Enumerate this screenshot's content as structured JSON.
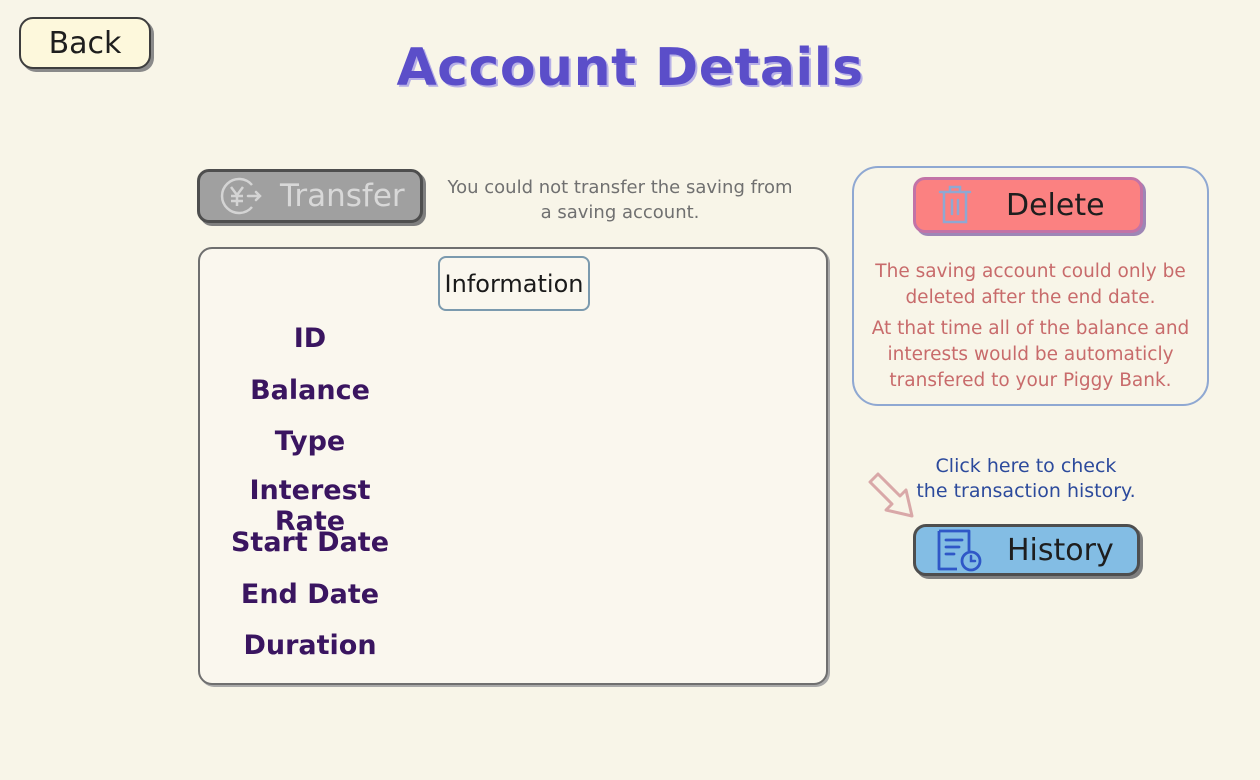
{
  "header": {
    "back_label": "Back",
    "title": "Account Details"
  },
  "transfer": {
    "label": "Transfer",
    "icon": "yen-transfer-icon",
    "disabled": true,
    "note_line1": "You could not transfer the saving from",
    "note_line2": "a saving account."
  },
  "info": {
    "tag": "Information",
    "fields": [
      "ID",
      "Balance",
      "Type",
      "Interest Rate",
      "Start Date",
      "End Date",
      "Duration"
    ]
  },
  "delete": {
    "label": "Delete",
    "icon": "trash-icon",
    "note_line1": "The saving account could only be",
    "note_line2": "deleted after the end date.",
    "note_line3": "At that time all of the balance and",
    "note_line4": "interests would be automaticly",
    "note_line5": "transfered to your Piggy Bank."
  },
  "history": {
    "hint_line1": "Click here to check",
    "hint_line2": "the transaction history.",
    "label": "History",
    "icon": "document-clock-icon"
  },
  "colors": {
    "background": "#f8f5e8",
    "title": "#5b4ec9",
    "field_label": "#3a1560",
    "delete_button": "#fb8181",
    "delete_note": "#c86b6b",
    "history_button": "#83bde4",
    "history_hint": "#2c4a9c",
    "transfer_disabled": "#a0a0a0"
  }
}
